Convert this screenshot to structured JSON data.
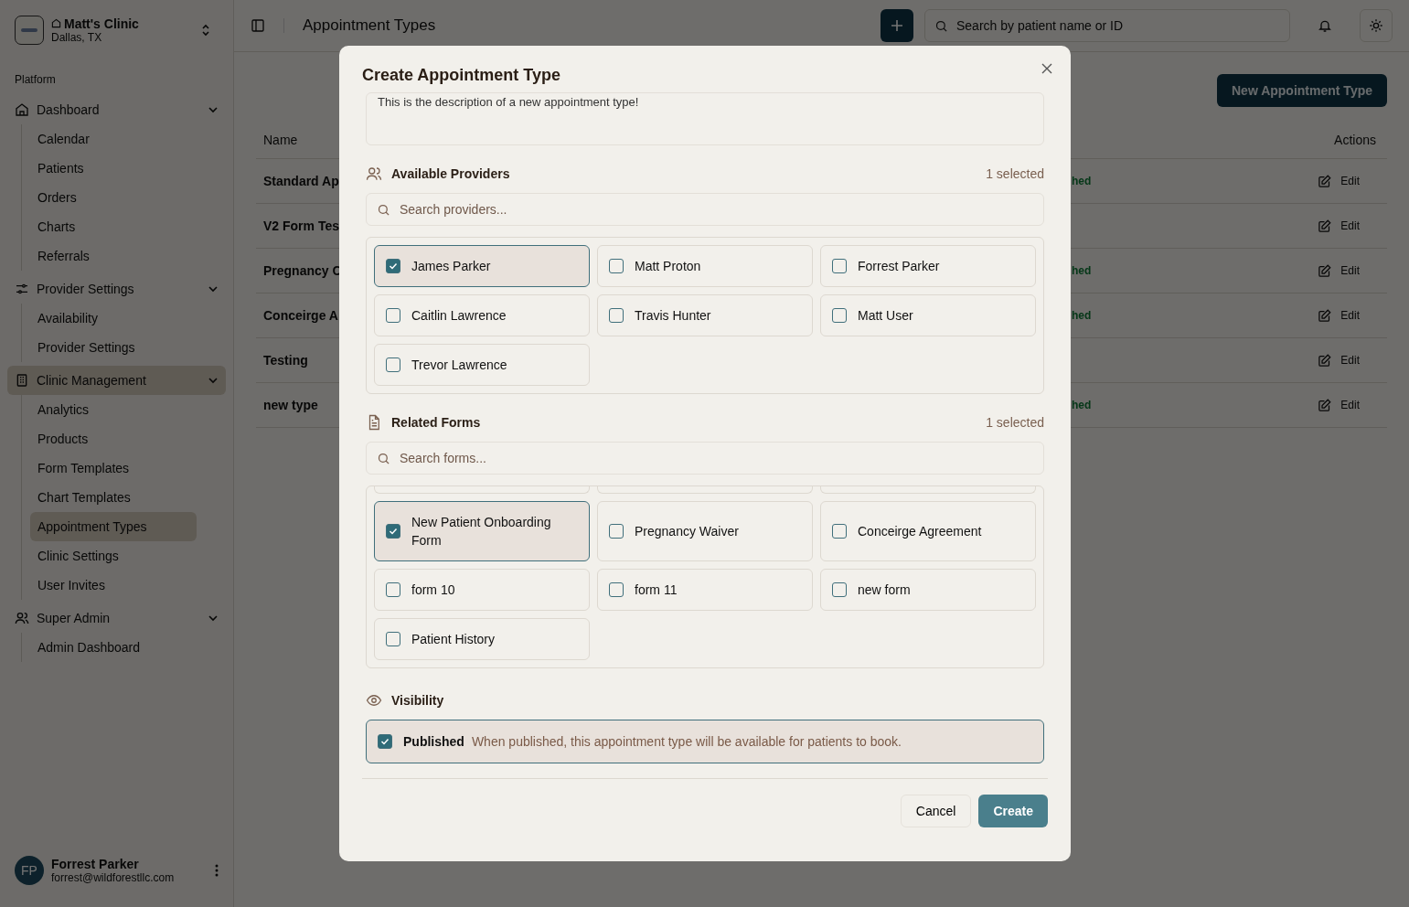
{
  "clinic": {
    "name": "Matt's Clinic",
    "location": "Dallas, TX"
  },
  "sidebar": {
    "section": "Platform",
    "groups": [
      {
        "label": "Dashboard",
        "expanded": true,
        "selected": false,
        "children": [
          {
            "label": "Calendar",
            "selected": false
          },
          {
            "label": "Patients",
            "selected": false
          },
          {
            "label": "Orders",
            "selected": false
          },
          {
            "label": "Charts",
            "selected": false
          },
          {
            "label": "Referrals",
            "selected": false
          }
        ]
      },
      {
        "label": "Provider Settings",
        "expanded": true,
        "selected": false,
        "children": [
          {
            "label": "Availability",
            "selected": false
          },
          {
            "label": "Provider Settings",
            "selected": false
          }
        ]
      },
      {
        "label": "Clinic Management",
        "expanded": true,
        "selected": true,
        "children": [
          {
            "label": "Analytics",
            "selected": false
          },
          {
            "label": "Products",
            "selected": false
          },
          {
            "label": "Form Templates",
            "selected": false
          },
          {
            "label": "Chart Templates",
            "selected": false
          },
          {
            "label": "Appointment Types",
            "selected": true
          },
          {
            "label": "Clinic Settings",
            "selected": false
          },
          {
            "label": "User Invites",
            "selected": false
          }
        ]
      },
      {
        "label": "Super Admin",
        "expanded": true,
        "selected": false,
        "children": [
          {
            "label": "Admin Dashboard",
            "selected": false
          }
        ]
      }
    ]
  },
  "user": {
    "initials": "FP",
    "name": "Forrest Parker",
    "email": "forrest@wildforestllc.com"
  },
  "topbar": {
    "title": "Appointment Types",
    "search_placeholder": "Search by patient name or ID"
  },
  "new_button": "New Appointment Type",
  "table": {
    "columns": [
      "Name",
      "Actions"
    ],
    "rows": [
      {
        "name": "Standard Ap",
        "status": "hed",
        "action": "Edit"
      },
      {
        "name": "V2 Form Tes",
        "action": "Edit"
      },
      {
        "name": "Pregnancy C",
        "status": "hed",
        "action": "Edit"
      },
      {
        "name": "Conceirge A",
        "status": "hed",
        "action": "Edit"
      },
      {
        "name": "Testing",
        "action": "Edit"
      },
      {
        "name": "new type",
        "status": "hed",
        "action": "Edit"
      }
    ]
  },
  "dialog": {
    "title": "Create Appointment Type",
    "description": "This is the description of a new appointment type!",
    "providers": {
      "label": "Available Providers",
      "count": "1 selected",
      "placeholder": "Search providers...",
      "items": [
        {
          "name": "James Parker",
          "checked": true
        },
        {
          "name": "Matt Proton",
          "checked": false
        },
        {
          "name": "Forrest Parker",
          "checked": false
        },
        {
          "name": "Caitlin Lawrence",
          "checked": false
        },
        {
          "name": "Travis Hunter",
          "checked": false
        },
        {
          "name": "Matt User",
          "checked": false
        },
        {
          "name": "Trevor Lawrence",
          "checked": false
        }
      ]
    },
    "forms": {
      "label": "Related Forms",
      "count": "1 selected",
      "placeholder": "Search forms...",
      "items": [
        {
          "name": "New Patient Onboarding Form",
          "checked": true
        },
        {
          "name": "Pregnancy Waiver",
          "checked": false
        },
        {
          "name": "Conceirge Agreement",
          "checked": false
        },
        {
          "name": "form 10",
          "checked": false
        },
        {
          "name": "form 11",
          "checked": false
        },
        {
          "name": "new form",
          "checked": false
        },
        {
          "name": "Patient History",
          "checked": false
        }
      ]
    },
    "visibility": {
      "label": "Visibility",
      "option": "Published",
      "hint": "When published, this appointment type will be available for patients to book.",
      "checked": true
    },
    "buttons": {
      "cancel": "Cancel",
      "create": "Create"
    }
  }
}
